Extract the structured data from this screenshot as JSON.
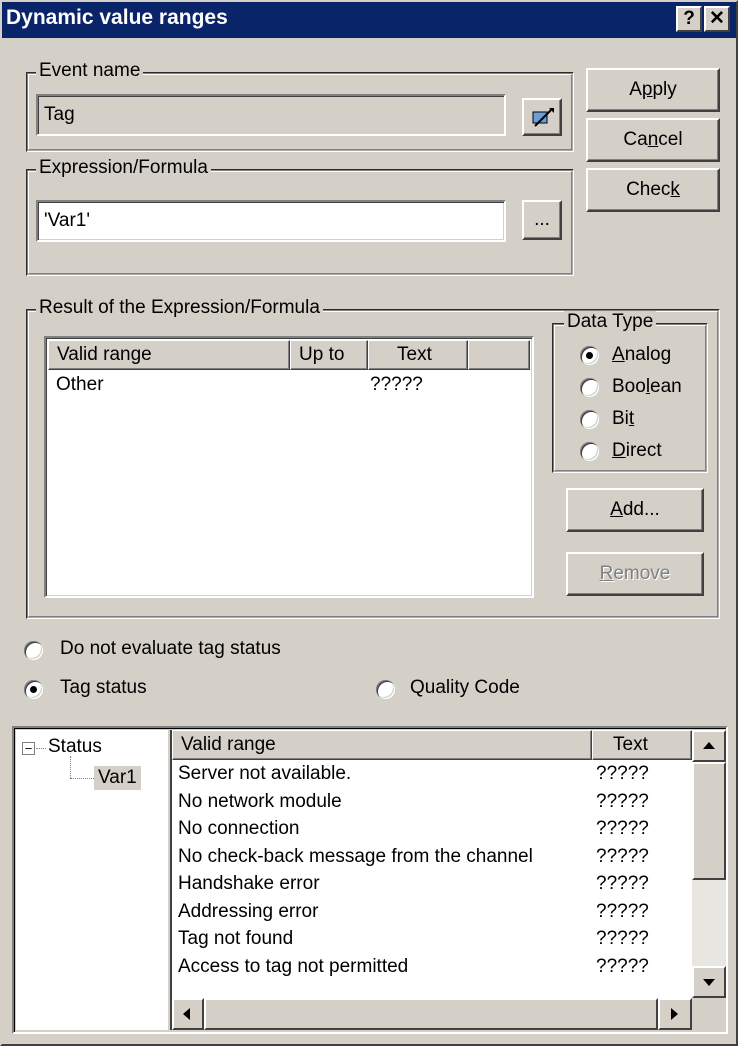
{
  "window": {
    "title": "Dynamic value ranges",
    "help_glyph": "?",
    "close_glyph": "✕"
  },
  "event_group": {
    "legend": "Event name",
    "value": "Tag",
    "select_icon": "tag-select-icon"
  },
  "expression_group": {
    "legend": "Expression/Formula",
    "value": "'Var1'",
    "browse_label": "..."
  },
  "buttons": {
    "apply": "Apply",
    "cancel": "Cancel",
    "check": "Check",
    "add": "Add...",
    "remove": "Remove"
  },
  "result_group": {
    "legend": "Result of the Expression/Formula",
    "columns": [
      "Valid range",
      "Up to",
      "Text",
      ""
    ],
    "rows": [
      {
        "valid_range": "Other",
        "up_to": "",
        "text": "?????"
      }
    ]
  },
  "data_type": {
    "legend": "Data Type",
    "options": [
      "Analog",
      "Boolean",
      "Bit",
      "Direct"
    ],
    "selected": "Analog"
  },
  "tag_status_options": {
    "do_not_evaluate": "Do not evaluate tag status",
    "tag_status": "Tag status",
    "quality_code": "Quality Code",
    "selected": "Tag status"
  },
  "tree": {
    "root": "Status",
    "root_toggle": "−",
    "child": "Var1"
  },
  "status_table": {
    "columns": [
      "Valid range",
      "Text"
    ],
    "rows": [
      {
        "range": "Server not available.",
        "text": "?????"
      },
      {
        "range": "No network module",
        "text": "?????"
      },
      {
        "range": "No connection",
        "text": "?????"
      },
      {
        "range": "No check-back message from the channel",
        "text": "?????"
      },
      {
        "range": "Handshake error",
        "text": "?????"
      },
      {
        "range": "Addressing error",
        "text": "?????"
      },
      {
        "range": "Tag not found",
        "text": "?????"
      },
      {
        "range": "Access to tag not permitted",
        "text": "?????"
      }
    ]
  },
  "colors": {
    "titlebar": "#0a246a",
    "face": "#d4d0c8",
    "selected_tree_item": "#d4d0c8"
  }
}
